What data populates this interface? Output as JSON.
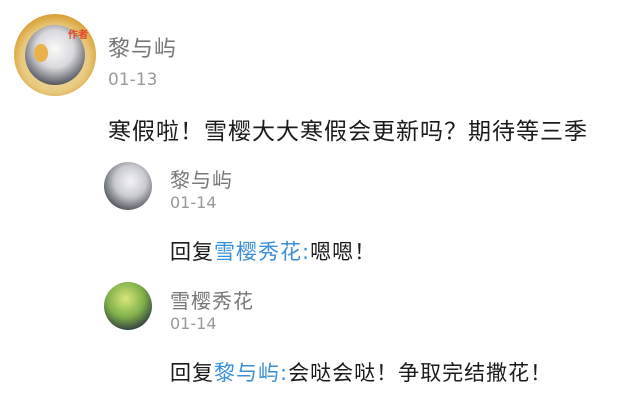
{
  "comment": {
    "author": "黎与屿",
    "author_badge": "作者",
    "time": "01-13",
    "text": "寒假啦！雪樱大大寒假会更新吗？期待等三季"
  },
  "replies": [
    {
      "author": "黎与屿",
      "time": "01-14",
      "prefix": "回复",
      "mention": "雪樱秀花:",
      "text": "嗯嗯！"
    },
    {
      "author": "雪樱秀花",
      "time": "01-14",
      "prefix": "回复",
      "mention": "黎与屿:",
      "text": "会哒会哒！争取完结撒花！"
    }
  ],
  "colors": {
    "mention": "#3a8fd6",
    "name": "#777777",
    "time": "#999999",
    "text": "#1a1a1a"
  }
}
